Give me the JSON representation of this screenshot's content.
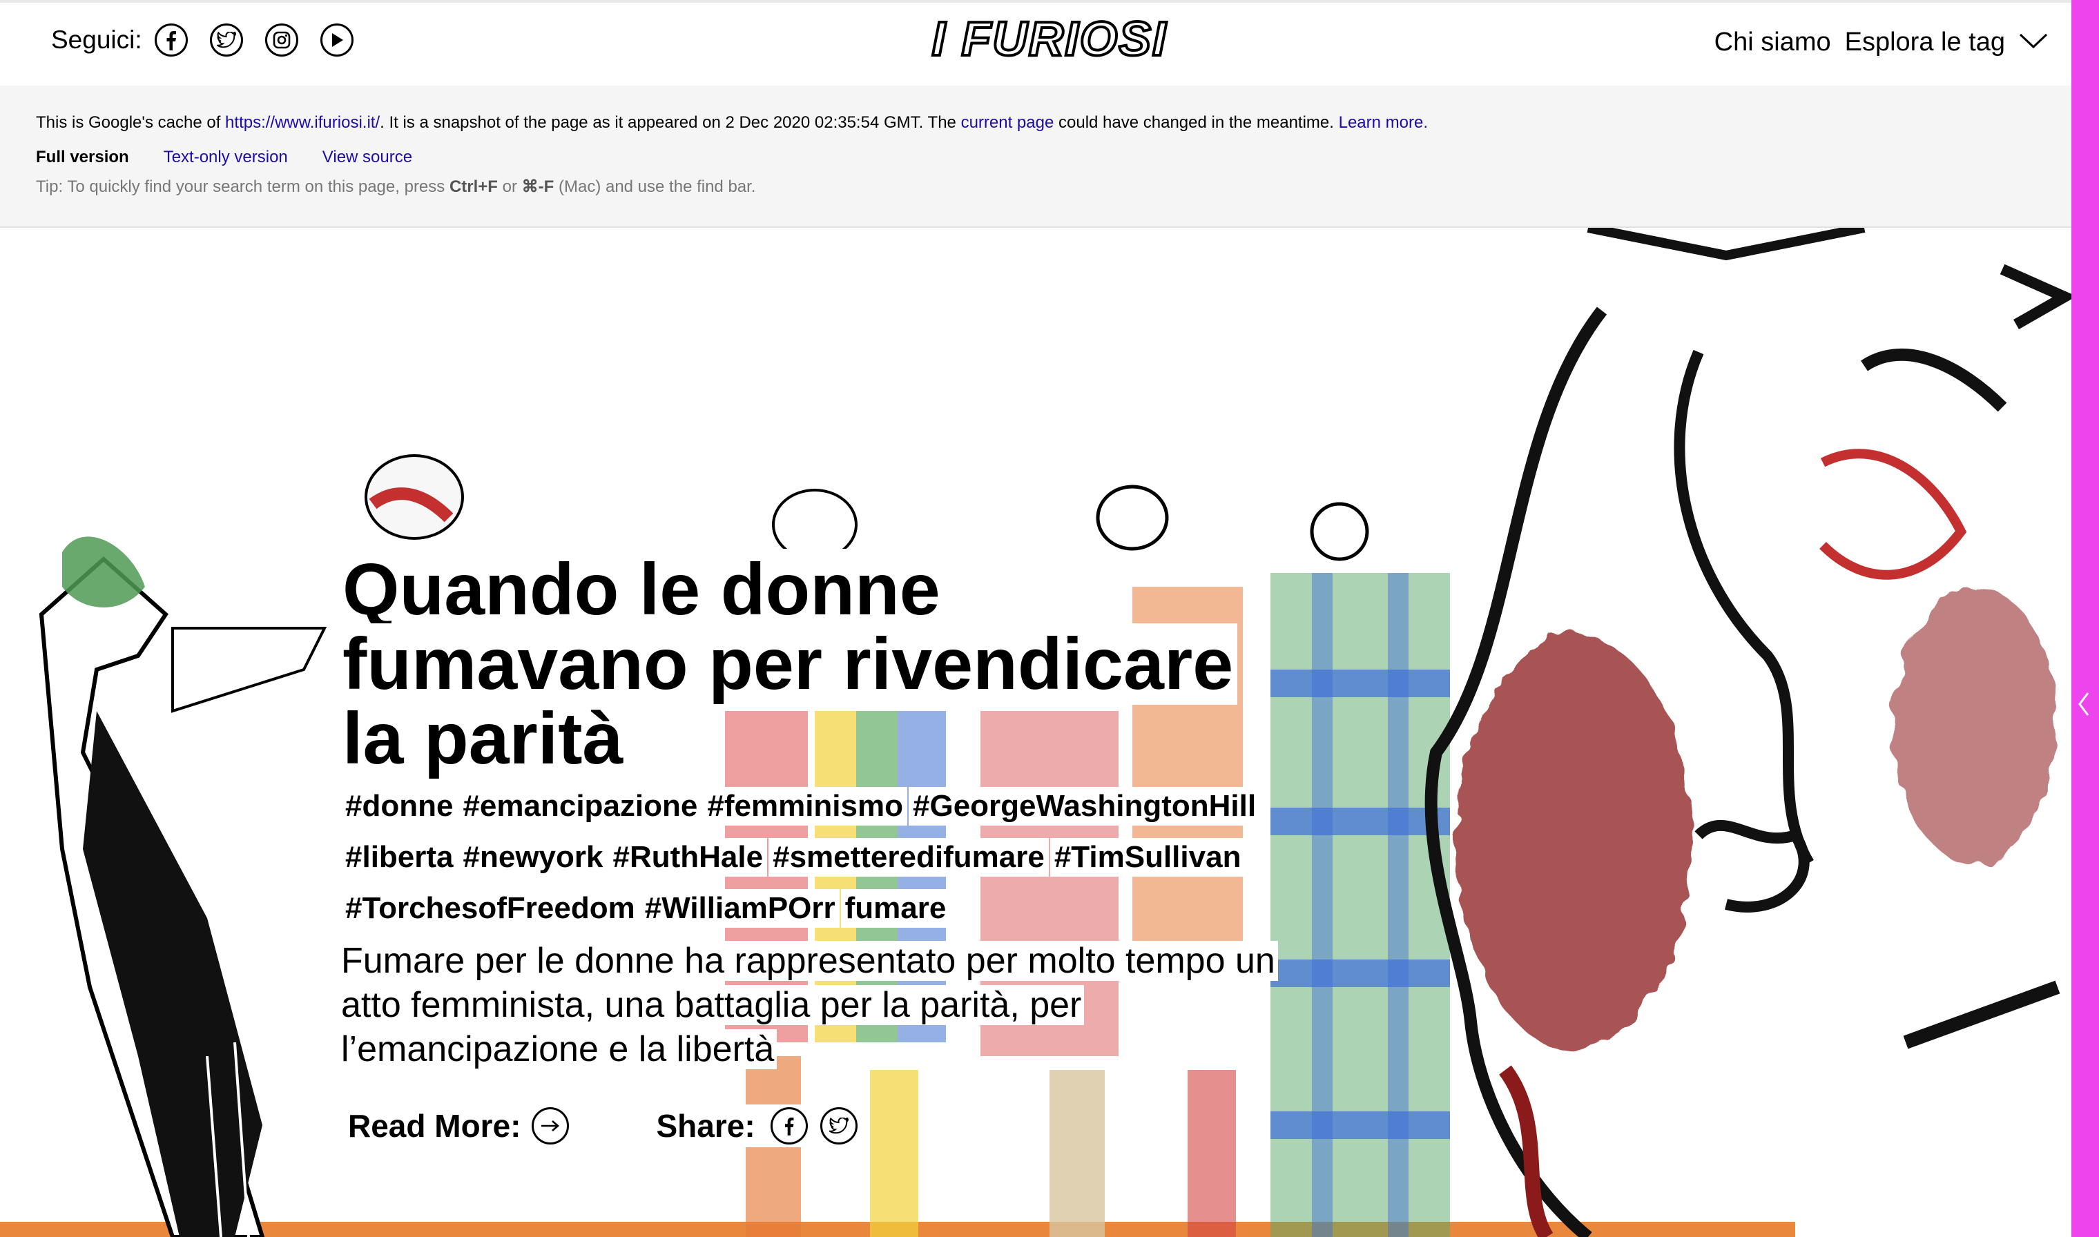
{
  "header": {
    "follow_label": "Seguici:",
    "social": [
      {
        "icon": "facebook-icon"
      },
      {
        "icon": "twitter-icon"
      },
      {
        "icon": "instagram-icon"
      },
      {
        "icon": "youtube-play-icon"
      }
    ],
    "logo_text": "I FURIOSI",
    "nav": {
      "about": "Chi siamo",
      "explore_tags": "Esplora le tag"
    }
  },
  "cache_banner": {
    "line_prefix": "This is Google's cache of ",
    "cached_url": "https://www.ifuriosi.it/",
    "line_middle": ". It is a snapshot of the page as it appeared on 2 Dec 2020 02:35:54 GMT. The ",
    "current_page": "current page",
    "line_suffix": " could have changed in the meantime. ",
    "learn_more": "Learn more.",
    "links": {
      "full": "Full version",
      "text_only": "Text-only version",
      "view_source": "View source"
    },
    "tip_prefix": "Tip: To quickly find your search term on this page, press ",
    "tip_key1": "Ctrl+F",
    "tip_or": " or ",
    "tip_key2": "⌘-F",
    "tip_suffix": " (Mac) and use the find bar."
  },
  "article": {
    "title": "Quando le donne fumavano per rivendicare la parità",
    "tags": [
      "#donne",
      "#emancipazione",
      "#femminismo",
      "#GeorgeWashingtonHill",
      "#liberta",
      "#newyork",
      "#RuthHale",
      "#smetteredifumare",
      "#TimSullivan",
      "#TorchesofFreedom",
      "#WilliamPOrr",
      "fumare"
    ],
    "abstract": "Fumare per le donne ha rappresentato per molto tempo un atto femminista, una battaglia per la parità, per l’emancipazione e la libertà",
    "read_more_label": "Read More:",
    "share_label": "Share:"
  },
  "colors": {
    "side_strip": "#ee44ee",
    "cache_link": "#1a0dab",
    "cache_bg": "#f5f5f5",
    "illustration_red": "#8b1a1a"
  }
}
